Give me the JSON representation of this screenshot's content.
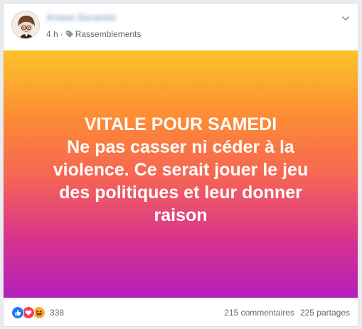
{
  "post": {
    "author": "Ariane Gerardet",
    "time": "4 h",
    "separator": "·",
    "group": "Rassemblements",
    "text_lines": [
      "VITALE POUR SAMEDI",
      "Ne pas casser ni céder à la",
      "violence. Ce serait jouer le jeu",
      "des politiques et leur donner",
      "raison"
    ],
    "gradient_colors": [
      "#fcc32c",
      "#fd8a35",
      "#f56357",
      "#d8348c",
      "#b320bd"
    ]
  },
  "reactions": {
    "icons": [
      "like-icon",
      "love-icon",
      "haha-icon"
    ],
    "colors": {
      "like": "#2078f4",
      "love": "#f33e58",
      "haha": "#f7b125"
    },
    "count": "338"
  },
  "stats": {
    "comments": "215 commentaires",
    "shares": "225 partages"
  }
}
